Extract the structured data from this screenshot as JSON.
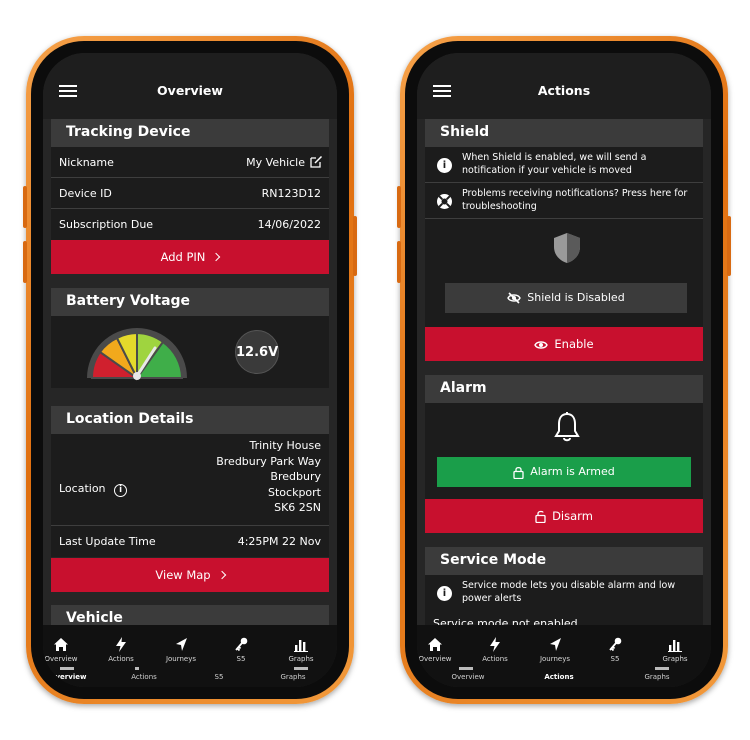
{
  "overview": {
    "title": "Overview",
    "tracking": {
      "heading": "Tracking Device",
      "nickname_label": "Nickname",
      "nickname_value": "My Vehicle",
      "device_id_label": "Device ID",
      "device_id_value": "RN123D12",
      "subscription_label": "Subscription Due",
      "subscription_value": "14/06/2022",
      "add_pin_label": "Add PIN"
    },
    "battery": {
      "heading": "Battery Voltage",
      "reading": "12.6V",
      "gauge_level": 0.78
    },
    "location": {
      "heading": "Location Details",
      "label": "Location",
      "address": [
        "Trinity House",
        "Bredbury Park Way",
        "Bredbury",
        "Stockport",
        "SK6 2SN"
      ],
      "last_update_label": "Last Update Time",
      "last_update_value": "4:25PM 22 Nov",
      "view_map_label": "View Map"
    },
    "vehicle_heading": "Vehicle",
    "nav": {
      "items": [
        "Overview",
        "Actions",
        "Journeys",
        "S5",
        "Graphs"
      ],
      "secondary": [
        "Overview",
        "Actions",
        "S5",
        "Graphs"
      ],
      "active": "Overview"
    }
  },
  "actions": {
    "title": "Actions",
    "shield": {
      "heading": "Shield",
      "info_text_1": "When Shield is enabled, we will send a",
      "info_text_2": "notification if your vehicle is moved",
      "help_text_1": "Problems receiving notifications? Press here for",
      "help_text_2": "troubleshooting",
      "status_label": "Shield is Disabled",
      "enable_label": "Enable"
    },
    "alarm": {
      "heading": "Alarm",
      "status_label": "Alarm is Armed",
      "disarm_label": "Disarm"
    },
    "service": {
      "heading": "Service Mode",
      "info_text_1": "Service mode lets you disable alarm and low",
      "info_text_2": "power alerts",
      "status_text": "Service mode not enabled"
    },
    "nav": {
      "items": [
        "Overview",
        "Actions",
        "Journeys",
        "S5",
        "Graphs"
      ],
      "secondary": [
        "Overview",
        "Actions",
        "Graphs"
      ],
      "active": "Actions"
    }
  },
  "colors": {
    "accent_red": "#c8102e",
    "accent_green": "#1a9e4a",
    "frame_orange": "#e8791a",
    "background": "#262626"
  },
  "icons": [
    "menu-icon",
    "edit-icon",
    "chevron-right-icon",
    "gauge-icon",
    "info-icon",
    "lifebuoy-icon",
    "shield-icon",
    "eye-slash-icon",
    "eye-icon",
    "bell-icon",
    "lock-icon",
    "unlock-icon",
    "home-icon",
    "lightning-icon",
    "navigation-arrow-icon",
    "key-icon",
    "bar-chart-icon"
  ]
}
